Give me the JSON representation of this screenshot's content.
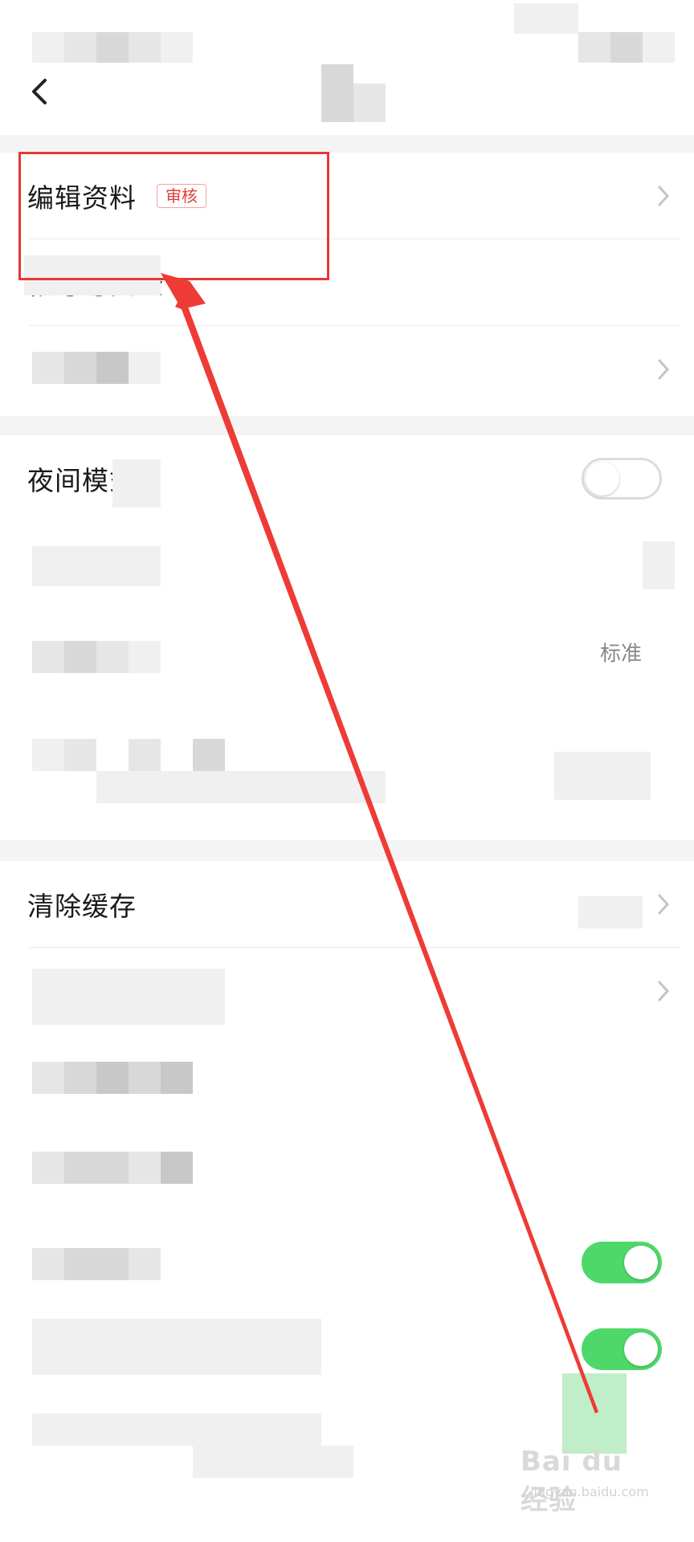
{
  "header": {
    "status_bar": "status-bar",
    "nav_title": "",
    "back_icon": "back-arrow-icon"
  },
  "account_group": {
    "edit_profile": {
      "label": "编辑资料",
      "badge": "审核"
    },
    "account_security": {
      "label": "帐号与安全"
    },
    "privacy": {
      "label": ""
    }
  },
  "display_group": {
    "night_mode": {
      "label": "夜间模式",
      "toggle": false
    },
    "mode_row": {
      "label": ""
    },
    "font_size": {
      "label": "",
      "value": "标准"
    },
    "auto_row": {
      "label": ""
    }
  },
  "storage_group": {
    "clear_cache": {
      "label": "清除缓存"
    },
    "play_network": {
      "label": ""
    }
  },
  "misc_group": {
    "row_a": {
      "label": ""
    },
    "row_b": {
      "label": ""
    },
    "row_c": {
      "label": "",
      "toggle": true
    },
    "row_d": {
      "label": "",
      "toggle": true
    },
    "row_e": {
      "label": ""
    }
  },
  "annotation": {
    "color": "#e53935",
    "target": "edit-profile-row"
  },
  "watermark": {
    "main": "Bai du 经验",
    "sub": "jingyan.baidu.com"
  },
  "colors": {
    "toggle_on": "#4fd86a",
    "badge_red": "#e0403a",
    "section_gap": "#f4f4f4"
  }
}
